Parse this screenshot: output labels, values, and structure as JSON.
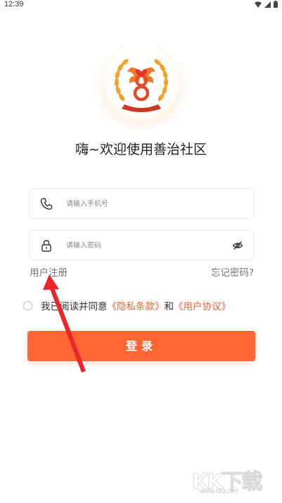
{
  "status_bar": {
    "time": "12:39",
    "icons": [
      "wifi-icon",
      "signal-icon",
      "battery-icon"
    ]
  },
  "logo": {
    "icon": "phoenix-laurel-logo",
    "accent": "#e24a2a",
    "gold": "#f2a22c"
  },
  "welcome_text": "嗨~欢迎使用善治社区",
  "phone_field": {
    "placeholder": "请输入手机号",
    "value": "",
    "icon": "phone-icon"
  },
  "password_field": {
    "placeholder": "请输入密码",
    "value": "",
    "icon": "lock-icon",
    "toggle_icon": "eye-slash-icon"
  },
  "links": {
    "register": "用户注册",
    "forgot": "忘记密码?"
  },
  "agreement": {
    "prefix": "我已阅读并同意",
    "privacy": "《隐私条款》",
    "and": "和",
    "user_agreement": "《用户协议》",
    "checked": false
  },
  "login_button": "登录",
  "colors": {
    "primary": "#ff6633",
    "link": "#f0632f",
    "annotation_arrow": "#e8262c"
  },
  "watermark": {
    "text": "KK下载",
    "url": "www.kkx.net"
  }
}
